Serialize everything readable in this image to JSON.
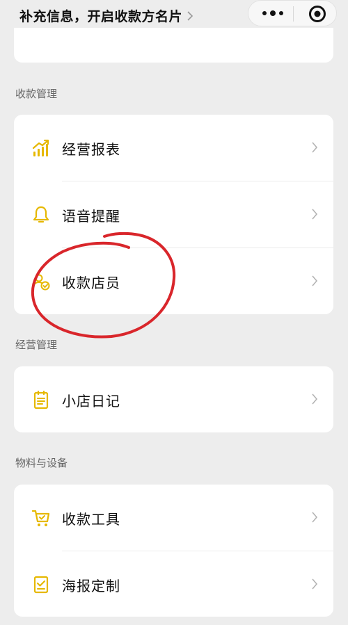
{
  "header": {
    "title": "补充信息，开启收款方名片",
    "capsule_icons": [
      "more-icon",
      "target-icon"
    ]
  },
  "sections": [
    {
      "title": "收款管理",
      "items": [
        {
          "label": "经营报表",
          "icon": "chart-icon"
        },
        {
          "label": "语音提醒",
          "icon": "bell-icon"
        },
        {
          "label": "收款店员",
          "icon": "clerk-icon"
        }
      ]
    },
    {
      "title": "经营管理",
      "items": [
        {
          "label": "小店日记",
          "icon": "notebook-icon"
        }
      ]
    },
    {
      "title": "物料与设备",
      "items": [
        {
          "label": "收款工具",
          "icon": "cart-icon"
        },
        {
          "label": "海报定制",
          "icon": "poster-icon"
        }
      ]
    }
  ],
  "colors": {
    "background": "#ededed",
    "card": "#ffffff",
    "accent_icon": "#e6b800",
    "annotation": "#d9262b"
  }
}
